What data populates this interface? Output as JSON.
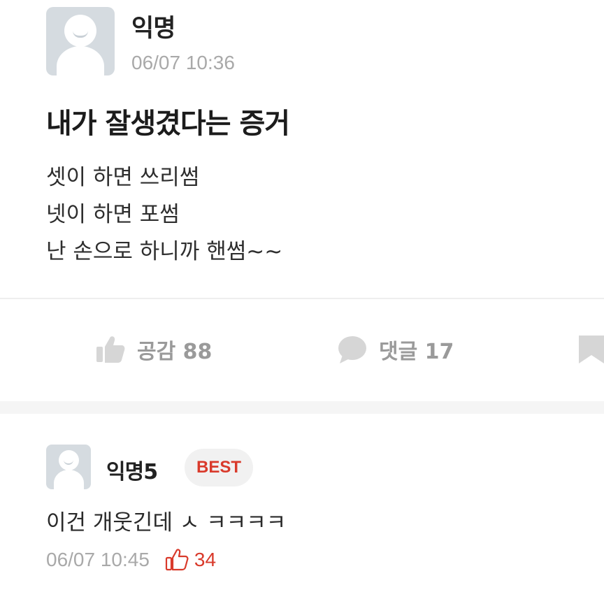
{
  "post": {
    "author": "익명",
    "timestamp": "06/07 10:36",
    "title": "내가 잘생겼다는 증거",
    "body_lines": [
      "셋이 하면 쓰리썸",
      "넷이 하면 포썸",
      "난 손으로 하니까 핸썸~~"
    ]
  },
  "actions": {
    "like_label": "공감 88",
    "comment_label": "댓글 17",
    "like_icon": "thumbs-up-icon",
    "comment_icon": "speech-bubble-icon",
    "save_icon": "bookmark-icon"
  },
  "comment": {
    "author": "익명5",
    "badge": "BEST",
    "text": "이건 개웃긴데 ㅅ   ㅋㅋㅋㅋ",
    "timestamp": "06/07 10:45",
    "like_count": "34"
  },
  "colors": {
    "accent_red": "#d93a2b",
    "muted_gray": "#9a9a9a",
    "avatar_bg": "#d5dbe0"
  }
}
